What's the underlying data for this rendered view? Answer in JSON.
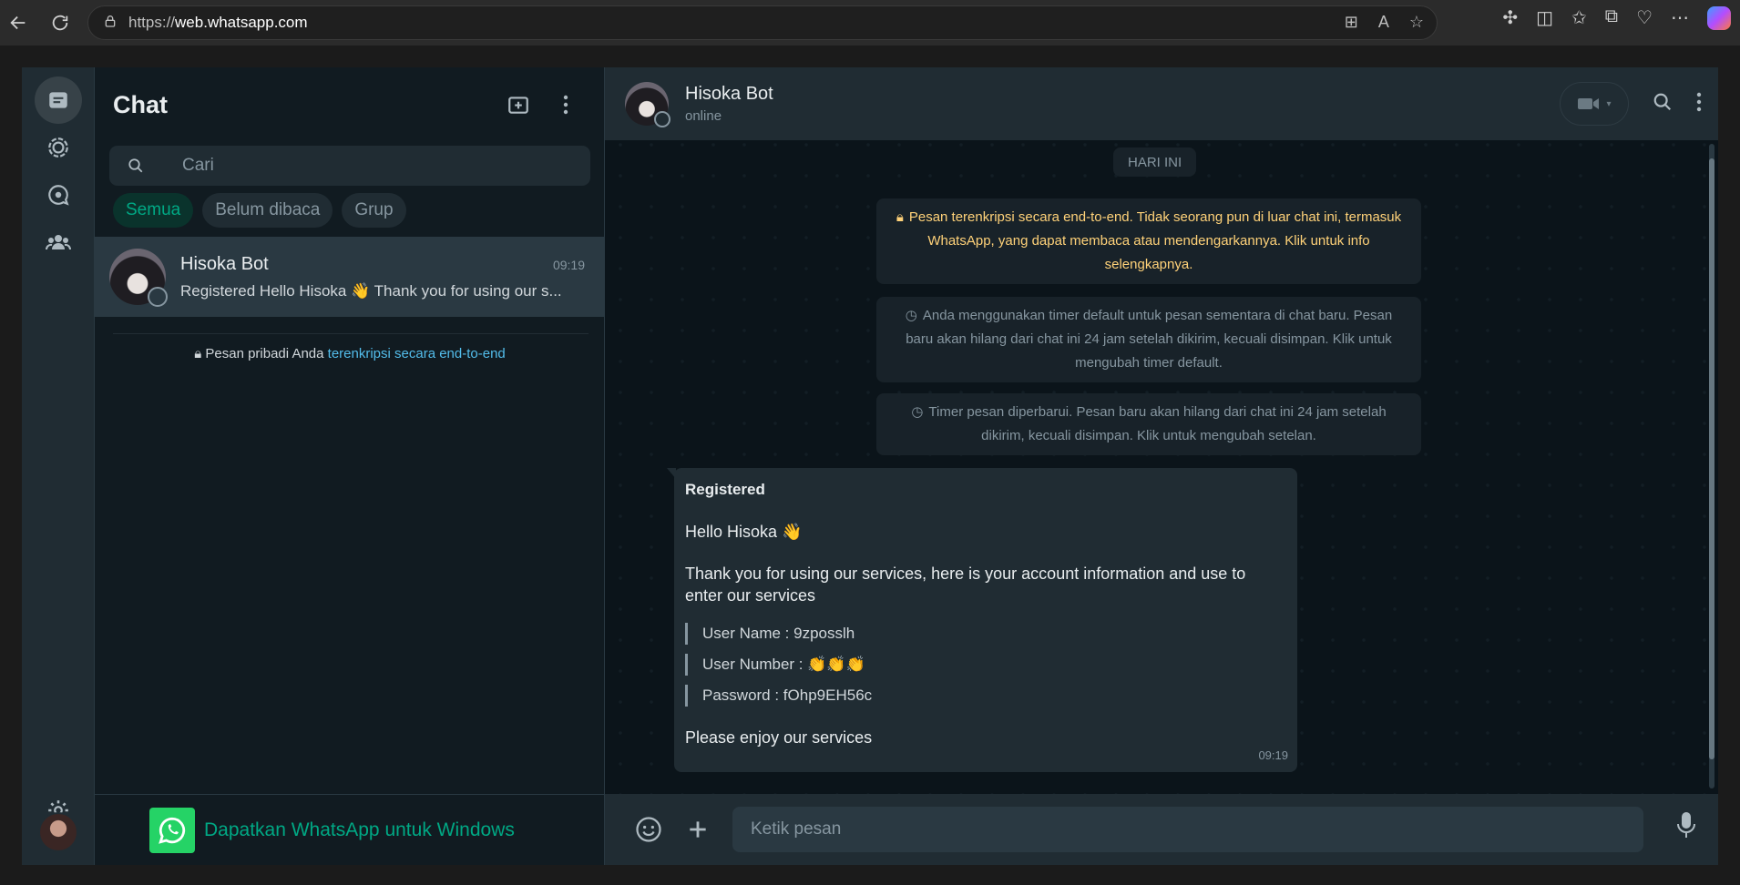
{
  "browser": {
    "url_prefix": "https://",
    "url_host": "web.whatsapp.com"
  },
  "rail": {
    "items": [
      "chats-icon",
      "status-icon",
      "channels-icon",
      "communities-icon"
    ],
    "settings": "settings-icon"
  },
  "chat_list": {
    "title": "Chat",
    "search_placeholder": "Cari",
    "filters": [
      "Semua",
      "Belum dibaca",
      "Grup"
    ],
    "chats": [
      {
        "name": "Hisoka Bot",
        "time": "09:19",
        "preview": "Registered Hello Hisoka 👋 Thank you for using our s..."
      }
    ],
    "e2e_prefix": "Pesan pribadi Anda ",
    "e2e_link": "terenkripsi secara end-to-end",
    "download_text": "Dapatkan WhatsApp untuk Windows"
  },
  "conversation": {
    "contact_name": "Hisoka Bot",
    "contact_status": "online",
    "date_chip": "HARI INI",
    "system_messages": [
      "Pesan terenkripsi secara end-to-end. Tidak seorang pun di luar chat ini, termasuk WhatsApp, yang dapat membaca atau mendengarkannya. Klik untuk info selengkapnya.",
      "Anda menggunakan timer default untuk pesan sementara di chat baru. Pesan baru akan hilang dari chat ini 24 jam setelah dikirim, kecuali disimpan. Klik untuk mengubah timer default.",
      "Timer pesan diperbarui. Pesan baru akan hilang dari chat ini 24 jam setelah dikirim, kecuali disimpan. Klik untuk mengubah setelan."
    ],
    "message": {
      "title": "Registered",
      "greeting": "Hello Hisoka 👋",
      "body": "Thank you for using our services, here is your account information and use to enter our services",
      "username": "User Name : 9zposslh",
      "user_number": "User Number : 👏👏👏",
      "password": "Password : fOhp9EH56c",
      "closing": "Please enjoy our services",
      "time": "09:19"
    },
    "composer_placeholder": "Ketik pesan"
  },
  "colors": {
    "accent": "#00a884",
    "panel": "#111b21",
    "header": "#202c33",
    "system_yellow": "#ffd279"
  }
}
